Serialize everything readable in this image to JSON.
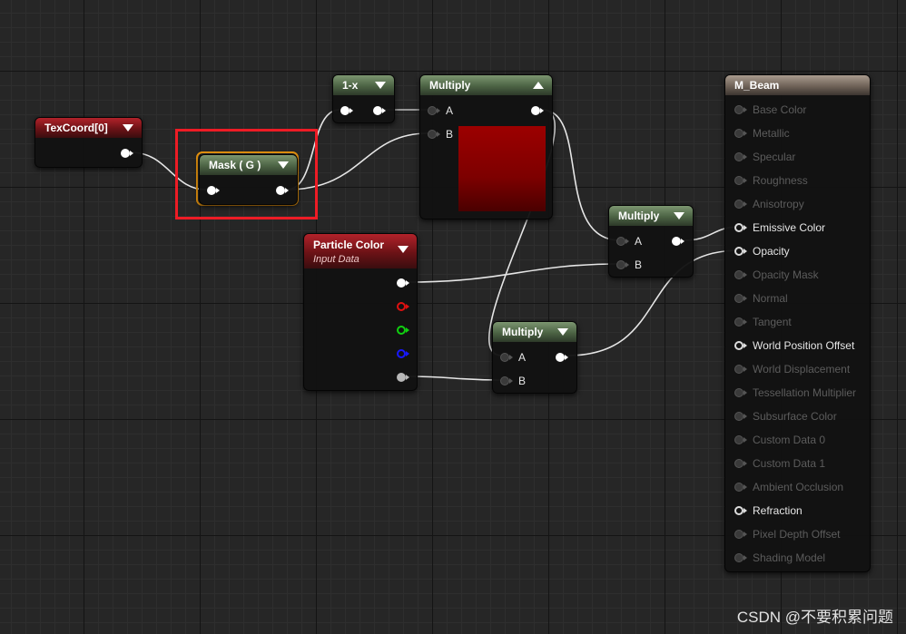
{
  "nodes": {
    "texcoord": {
      "title": "TexCoord[0]"
    },
    "mask": {
      "title": "Mask ( G )"
    },
    "one_minus": {
      "title": "1-x"
    },
    "multiply_top": {
      "title": "Multiply",
      "pin_a": "A",
      "pin_b": "B",
      "preview_color": "#8b0000"
    },
    "particle_color": {
      "title": "Particle Color",
      "subtitle": "Input Data"
    },
    "multiply_right": {
      "title": "Multiply",
      "pin_a": "A",
      "pin_b": "B"
    },
    "multiply_bottom": {
      "title": "Multiply",
      "pin_a": "A",
      "pin_b": "B"
    },
    "material": {
      "title": "M_Beam",
      "inputs": [
        {
          "label": "Base Color",
          "active": false
        },
        {
          "label": "Metallic",
          "active": false
        },
        {
          "label": "Specular",
          "active": false
        },
        {
          "label": "Roughness",
          "active": false
        },
        {
          "label": "Anisotropy",
          "active": false
        },
        {
          "label": "Emissive Color",
          "active": true
        },
        {
          "label": "Opacity",
          "active": true
        },
        {
          "label": "Opacity Mask",
          "active": false
        },
        {
          "label": "Normal",
          "active": false
        },
        {
          "label": "Tangent",
          "active": false
        },
        {
          "label": "World Position Offset",
          "active": true
        },
        {
          "label": "World Displacement",
          "active": false
        },
        {
          "label": "Tessellation Multiplier",
          "active": false
        },
        {
          "label": "Subsurface Color",
          "active": false
        },
        {
          "label": "Custom Data 0",
          "active": false
        },
        {
          "label": "Custom Data 1",
          "active": false
        },
        {
          "label": "Ambient Occlusion",
          "active": false
        },
        {
          "label": "Refraction",
          "active": true
        },
        {
          "label": "Pixel Depth Offset",
          "active": false
        },
        {
          "label": "Shading Model",
          "active": false
        }
      ]
    }
  },
  "colors": {
    "selection": "#e8950f",
    "highlight_box": "#ee1c25",
    "wire": "#e6e6e6"
  },
  "watermark": "CSDN @不要积累问题"
}
